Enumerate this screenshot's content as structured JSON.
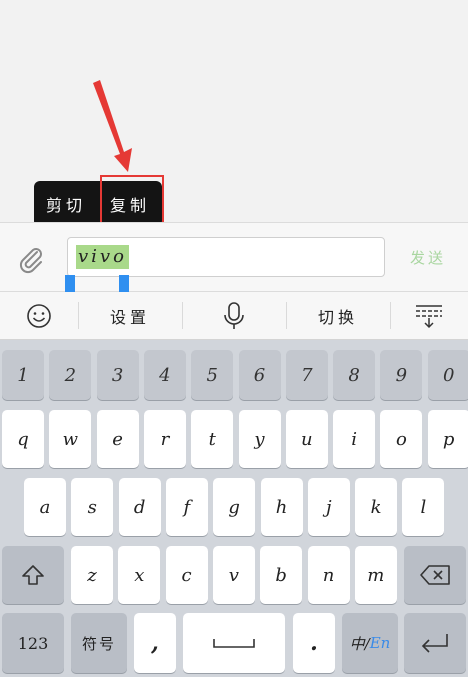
{
  "popup": {
    "cut_label": "剪切",
    "copy_label": "复制"
  },
  "input": {
    "value": "vivo",
    "send_label": "发送"
  },
  "toolbar": {
    "settings_label": "设置",
    "switch_label": "切换"
  },
  "keyboard": {
    "numbers": [
      "1",
      "2",
      "3",
      "4",
      "5",
      "6",
      "7",
      "8",
      "9",
      "0"
    ],
    "row1": [
      "q",
      "w",
      "e",
      "r",
      "t",
      "y",
      "u",
      "i",
      "o",
      "p"
    ],
    "row2": [
      "a",
      "s",
      "d",
      "f",
      "g",
      "h",
      "j",
      "k",
      "l"
    ],
    "row3": [
      "z",
      "x",
      "c",
      "v",
      "b",
      "n",
      "m"
    ],
    "num_switch_label": "123",
    "symbols_label": "符号",
    "comma_label": ",",
    "period_label": ".",
    "lang_cn": "中/",
    "lang_en": "En"
  },
  "colors": {
    "highlight": "#a9d98a",
    "handle": "#2f8ff0",
    "annotation": "#e53935",
    "send_disabled": "#a9d6a0"
  }
}
